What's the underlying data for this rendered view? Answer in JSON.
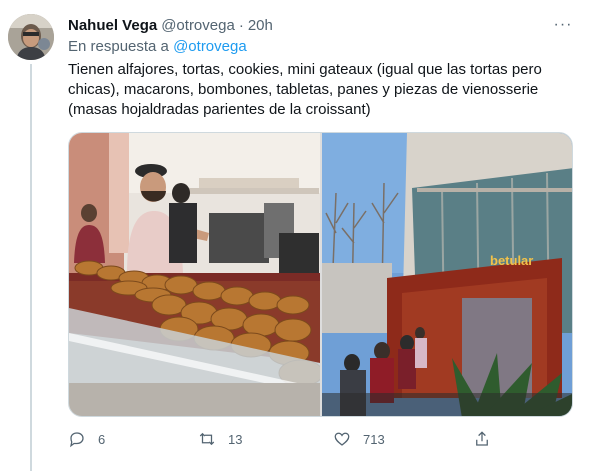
{
  "tweet": {
    "author_name": "Nahuel Vega",
    "handle": "@otrovega",
    "separator": "·",
    "time": "20h",
    "reply_prefix": "En respuesta a",
    "reply_to": "@otrovega",
    "text_lines": [
      "Tienen alfajores, tortas, cookies, mini gateaux (igual que las tortas pero",
      "chicas), macarons, bombones, tabletas, panes y piezas de vienosserie",
      "(masas hojaldradas parientes de la croissant)"
    ],
    "more_glyph": "···"
  },
  "media": {
    "sign_text": "betular"
  },
  "actions": {
    "replies": "6",
    "retweets": "13",
    "likes": "713"
  },
  "icons": [
    "reply-icon",
    "retweet-icon",
    "like-icon",
    "share-icon",
    "more-icon"
  ]
}
